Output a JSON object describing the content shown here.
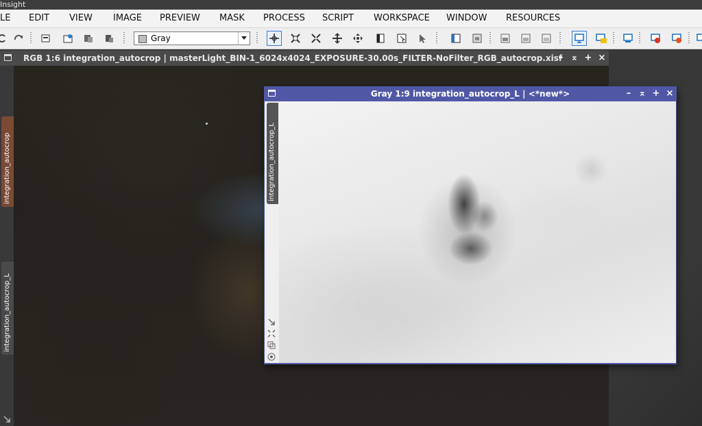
{
  "app": {
    "title": "Insight"
  },
  "menu": [
    "LE",
    "EDIT",
    "VIEW",
    "IMAGE",
    "PREVIEW",
    "MASK",
    "PROCESS",
    "SCRIPT",
    "WORKSPACE",
    "WINDOW",
    "RESOURCES"
  ],
  "toolbar": {
    "combo_value": "Gray",
    "icons": [
      "undo-icon",
      "redo-icon",
      "new-image-icon",
      "open-image-icon",
      "duplicate-icon",
      "copy-icon",
      "readout-icon",
      "zoom-fit-icon",
      "zoom-out-icon",
      "zoom-in-icon",
      "pan-icon",
      "channel-icon",
      "preview-icon",
      "pointer-icon",
      "window-icon",
      "screen-transfer-icon",
      "mask-icon",
      "mask-invert-icon",
      "mask-hide-icon",
      "monitor-icon",
      "24bit-monitor-icon",
      "stf-icon",
      "stf-reset-icon",
      "stf-clear-icon",
      "more-icon"
    ]
  },
  "windows": {
    "rgb": {
      "title": "RGB 1:6 integration_autocrop | masterLight_BIN-1_6024x4024_EXPOSURE-30.00s_FILTER-NoFilter_RGB_autocrop.xisf",
      "tab_primary": "integration_autocrop",
      "tab_secondary": "integration_autocrop_L"
    },
    "gray": {
      "title": "Gray 1:9 integration_autocrop_L | <*new*>",
      "tab": "integration_autocrop_L"
    }
  },
  "window_controls": {
    "minimize": "–",
    "shade": "⌅",
    "maximize": "+",
    "close": "×"
  },
  "colors": {
    "gray_window_frame": "#5058a6",
    "rgb_tab_active": "#7a4a35"
  }
}
